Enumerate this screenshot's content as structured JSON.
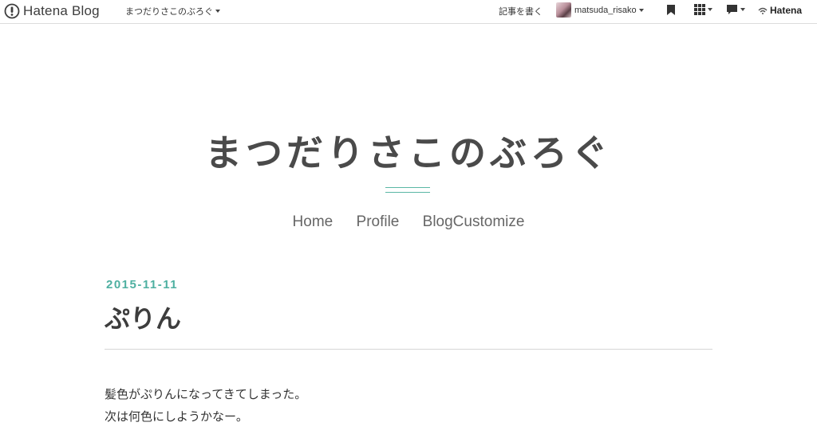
{
  "globalheader": {
    "brand": "Hatena Blog",
    "blog_menu": "まつだりさこのぶろぐ",
    "write_label": "記事を書く",
    "username": "matsuda_risako",
    "hatena": "Hatena"
  },
  "icons": {
    "logo": "hatena-blog-logo-icon",
    "bookmark": "bookmark-icon",
    "apps": "grid-icon",
    "notifications": "comment-icon",
    "hatena": "hatena-logo-icon"
  },
  "colors": {
    "accent": "#4eb0a1",
    "title": "#4a4a4a"
  },
  "blog": {
    "title": "まつだりさこのぶろぐ",
    "nav": [
      "Home",
      "Profile",
      "BlogCustomize"
    ]
  },
  "entry": {
    "date": "2015-11-11",
    "title": "ぷりん",
    "body": [
      "髪色がぷりんになってきてしまった。",
      "次は何色にしようかなー。"
    ]
  }
}
